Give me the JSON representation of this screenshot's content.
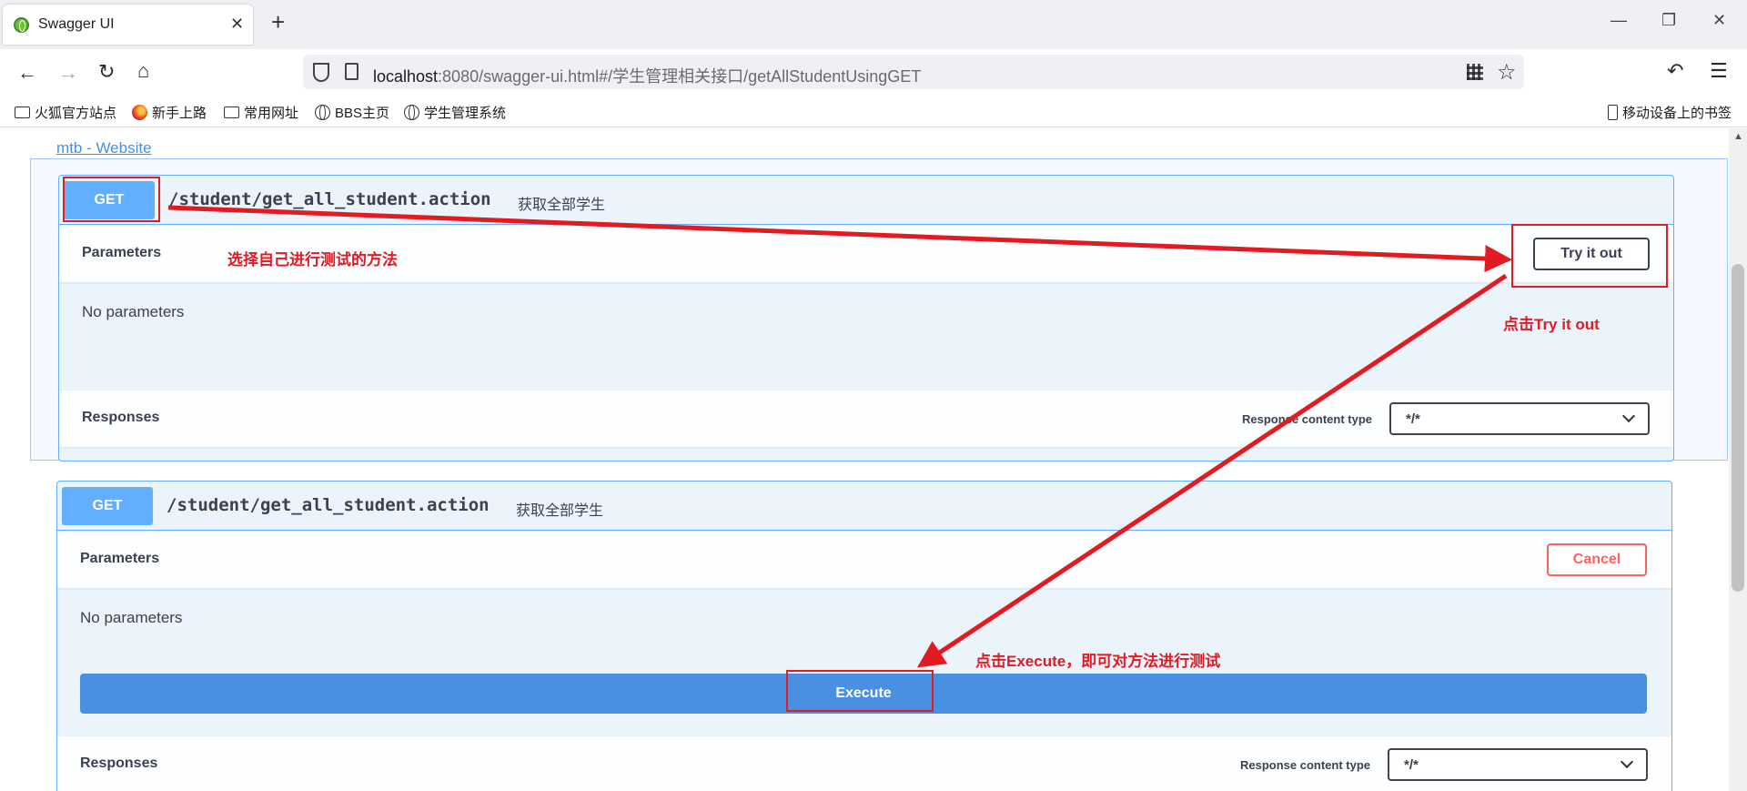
{
  "browser": {
    "tab_title": "Swagger UI",
    "tab_close": "✕",
    "new_tab": "+",
    "window_controls": {
      "minimize": "—",
      "restore": "❐",
      "close": "✕"
    },
    "nav": {
      "back": "←",
      "forward": "→",
      "reload": "↻",
      "home": "⌂"
    },
    "url_host": "localhost",
    "url_rest": ":8080/swagger-ui.html#/学生管理相关接口/getAllStudentUsingGET",
    "star": "☆",
    "undo": "↶",
    "menu": "☰",
    "bookmarks": [
      "火狐官方站点",
      "新手上路",
      "常用网址",
      "BBS主页",
      "学生管理系统"
    ],
    "mobile_bookmarks": "移动设备上的书签"
  },
  "page": {
    "site_link": "mtb - Website",
    "op1": {
      "method": "GET",
      "path": "/student/get_all_student.action",
      "summary": "获取全部学生",
      "parameters_title": "Parameters",
      "try_label": "Try it out",
      "no_params": "No parameters",
      "responses_title": "Responses",
      "content_type_label": "Response content type",
      "content_type_value": "*/*"
    },
    "op2": {
      "method": "GET",
      "path": "/student/get_all_student.action",
      "summary": "获取全部学生",
      "parameters_title": "Parameters",
      "cancel_label": "Cancel",
      "no_params": "No parameters",
      "execute_label": "Execute",
      "responses_title": "Responses",
      "content_type_label": "Response content type",
      "content_type_value": "*/*"
    }
  },
  "annotations": {
    "choose_method": "选择自己进行测试的方法",
    "click_try": "点击Try it out",
    "click_execute": "点击Execute，即可对方法进行测试",
    "color": "#e21b23"
  },
  "colors": {
    "get_method": "#61affe",
    "execute": "#4990e2",
    "cancel": "#ff6060",
    "text": "#3b4151"
  }
}
